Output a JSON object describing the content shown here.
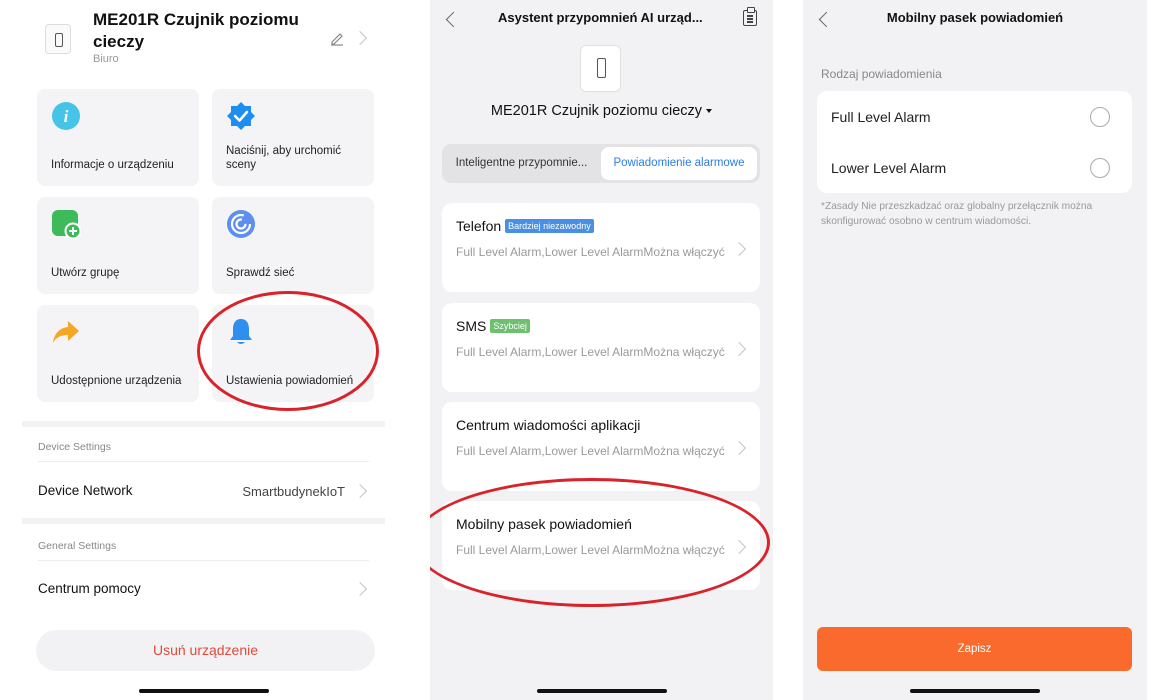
{
  "panel1": {
    "device_title": "ME201R Czujnik poziomu cieczy",
    "location": "Biuro",
    "tiles": [
      {
        "label": "Informacje o urządzeniu",
        "icon": "info-icon"
      },
      {
        "label": "Naciśnij, aby urchomić sceny",
        "icon": "scene-check-icon"
      },
      {
        "label": "Utwórz grupę",
        "icon": "add-group-icon"
      },
      {
        "label": "Sprawdź sieć",
        "icon": "network-check-icon"
      },
      {
        "label": "Udostępnione urządzenia",
        "icon": "share-icon"
      },
      {
        "label": "Ustawienia powiadomień",
        "icon": "bell-icon"
      }
    ],
    "device_settings_label": "Device Settings",
    "device_network_label": "Device Network",
    "device_network_value": "SmartbudynekIoT",
    "general_settings_label": "General Settings",
    "help_center_label": "Centrum pomocy",
    "delete_button": "Usuń urządzenie"
  },
  "panel2": {
    "nav_title": "Asystent przypomnień AI urząd...",
    "device_name": "ME201R Czujnik poziomu cieczy",
    "tabs": [
      "Inteligentne przypomnie...",
      "Powiadomienie alarmowe"
    ],
    "active_tab": "Powiadomienie alarmowe",
    "cards": [
      {
        "title": "Telefon",
        "badge": "Bardziej niezawodny",
        "badge_color": "#4a90e2",
        "desc": "Full Level Alarm,Lower Level AlarmMożna włączyć"
      },
      {
        "title": "SMS",
        "badge": "Szybciej",
        "badge_color": "#6cc070",
        "desc": "Full Level Alarm,Lower Level AlarmMożna włączyć"
      },
      {
        "title": "Centrum wiadomości aplikacji",
        "badge": "",
        "badge_color": "",
        "desc": "Full Level Alarm,Lower Level AlarmMożna włączyć"
      },
      {
        "title": "Mobilny pasek powiadomień",
        "badge": "",
        "badge_color": "",
        "desc": "Full Level Alarm,Lower Level AlarmMożna włączyć"
      }
    ]
  },
  "panel3": {
    "nav_title": "Mobilny pasek powiadomień",
    "section_label": "Rodzaj powiadomienia",
    "options": [
      {
        "label": "Full Level Alarm",
        "checked": false
      },
      {
        "label": "Lower Level Alarm",
        "checked": false
      }
    ],
    "note": "*Zasady Nie przeszkadzać oraz globalny przełącznik można skonfigurować osobno w centrum wiadomości.",
    "save_button": "Zapisz"
  },
  "colors": {
    "accent_blue": "#2b7de9",
    "save_orange": "#fa6a2c",
    "delete_red": "#e2493b",
    "highlight_red": "#d9232b"
  }
}
